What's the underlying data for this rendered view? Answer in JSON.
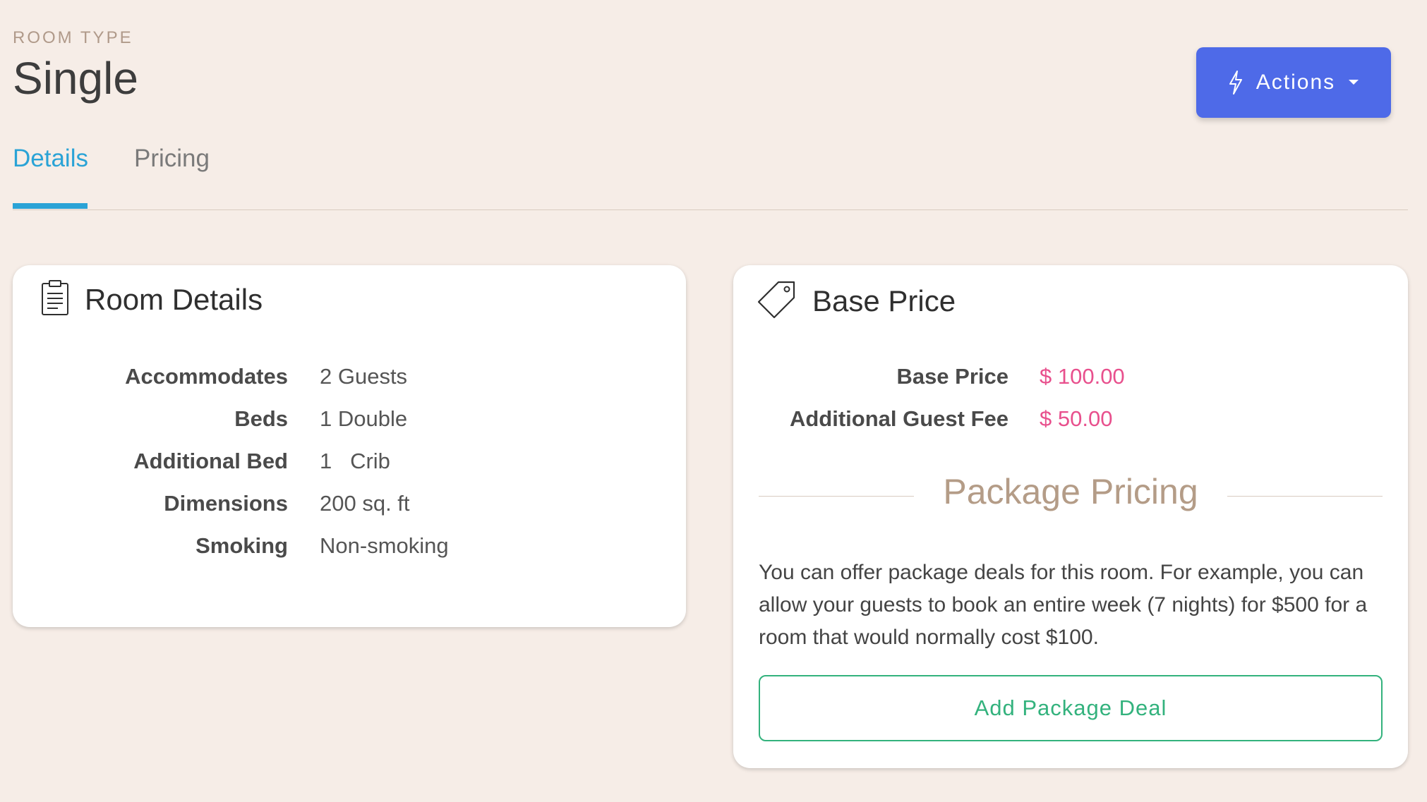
{
  "header": {
    "eyebrow": "ROOM TYPE",
    "title": "Single",
    "actions_label": "Actions"
  },
  "tabs": [
    {
      "label": "Details",
      "active": true
    },
    {
      "label": "Pricing",
      "active": false
    }
  ],
  "room_details": {
    "title": "Room Details",
    "rows": [
      {
        "label": "Accommodates",
        "value": "2 Guests"
      },
      {
        "label": "Beds",
        "value": "1 Double"
      },
      {
        "label": "Additional Bed",
        "value": "1   Crib"
      },
      {
        "label": "Dimensions",
        "value": "200 sq. ft"
      },
      {
        "label": "Smoking",
        "value": "Non-smoking"
      }
    ]
  },
  "base_price": {
    "title": "Base Price",
    "rows": [
      {
        "label": "Base Price",
        "value": "$ 100.00"
      },
      {
        "label": "Additional Guest Fee",
        "value": "$ 50.00"
      }
    ],
    "package_heading": "Package Pricing",
    "package_description": "You can offer package deals for this room. For example, you can allow your guests to book an entire week (7 nights) for $500 for a room that would normally cost $100.",
    "add_button_label": "Add Package Deal"
  },
  "colors": {
    "background": "#f6ede7",
    "accent_blue": "#2aa3d6",
    "actions_button": "#4e6ae8",
    "price_pink": "#e8508d",
    "success_green": "#33b27d"
  },
  "icons": {
    "actions": "lightning-icon",
    "actions_caret": "caret-down-icon",
    "room_details": "clipboard-icon",
    "base_price": "price-tag-icon"
  }
}
